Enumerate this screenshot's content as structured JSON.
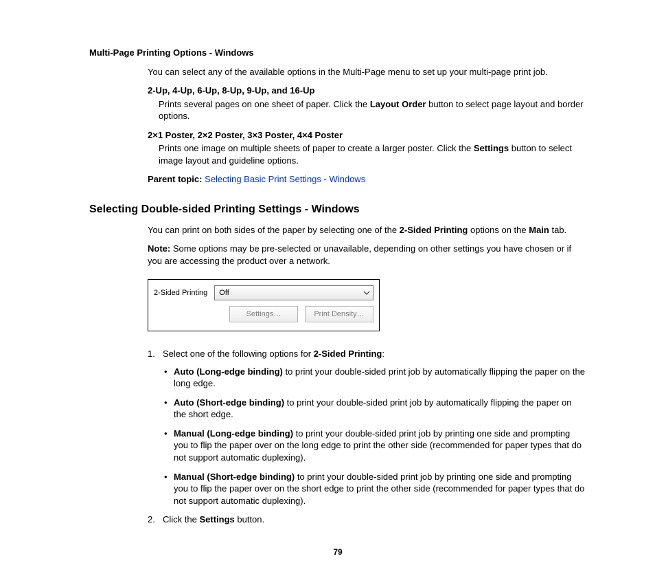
{
  "section1": {
    "title": "Multi-Page Printing Options - Windows",
    "intro": "You can select any of the available options in the Multi-Page menu to set up your multi-page print job.",
    "item1": {
      "term": "2-Up, 4-Up, 6-Up, 8-Up, 9-Up, and 16-Up",
      "def_pre": "Prints several pages on one sheet of paper. Click the ",
      "def_bold": "Layout Order",
      "def_post": " button to select page layout and border options."
    },
    "item2": {
      "term": "2×1 Poster, 2×2 Poster, 3×3 Poster, 4×4 Poster",
      "def_pre": "Prints one image on multiple sheets of paper to create a larger poster. Click the ",
      "def_bold": "Settings",
      "def_post": " button to select image layout and guideline options."
    },
    "parent_label": "Parent topic:",
    "parent_link": "Selecting Basic Print Settings - Windows"
  },
  "section2": {
    "title": "Selecting Double-sided Printing Settings - Windows",
    "intro_pre": "You can print on both sides of the paper by selecting one of the ",
    "intro_bold1": "2-Sided Printing",
    "intro_mid": " options on the ",
    "intro_bold2": "Main",
    "intro_post": " tab.",
    "note_label": "Note:",
    "note_text": " Some options may be pre-selected or unavailable, depending on other settings you have chosen or if you are accessing the product over a network.",
    "figure": {
      "label": "2-Sided Printing",
      "combo_value": "Off",
      "btn_settings": "Settings…",
      "btn_density": "Print Density…"
    },
    "step1": {
      "lead": "Select one of the following options for ",
      "lead_bold": "2-Sided Printing",
      "lead_post": ":",
      "opts": [
        {
          "term": "Auto (Long-edge binding)",
          "rest": " to print your double-sided print job by automatically flipping the paper on the long edge."
        },
        {
          "term": "Auto (Short-edge binding)",
          "rest": " to print your double-sided print job by automatically flipping the paper on the short edge."
        },
        {
          "term": "Manual (Long-edge binding)",
          "rest": " to print your double-sided print job by printing one side and prompting you to flip the paper over on the long edge to print the other side (recommended for paper types that do not support automatic duplexing)."
        },
        {
          "term": "Manual (Short-edge binding)",
          "rest": " to print your double-sided print job by printing one side and prompting you to flip the paper over on the short edge to print the other side (recommended for paper types that do not support automatic duplexing)."
        }
      ]
    },
    "step2": {
      "pre": "Click the ",
      "bold": "Settings",
      "post": " button."
    }
  },
  "page_number": "79"
}
